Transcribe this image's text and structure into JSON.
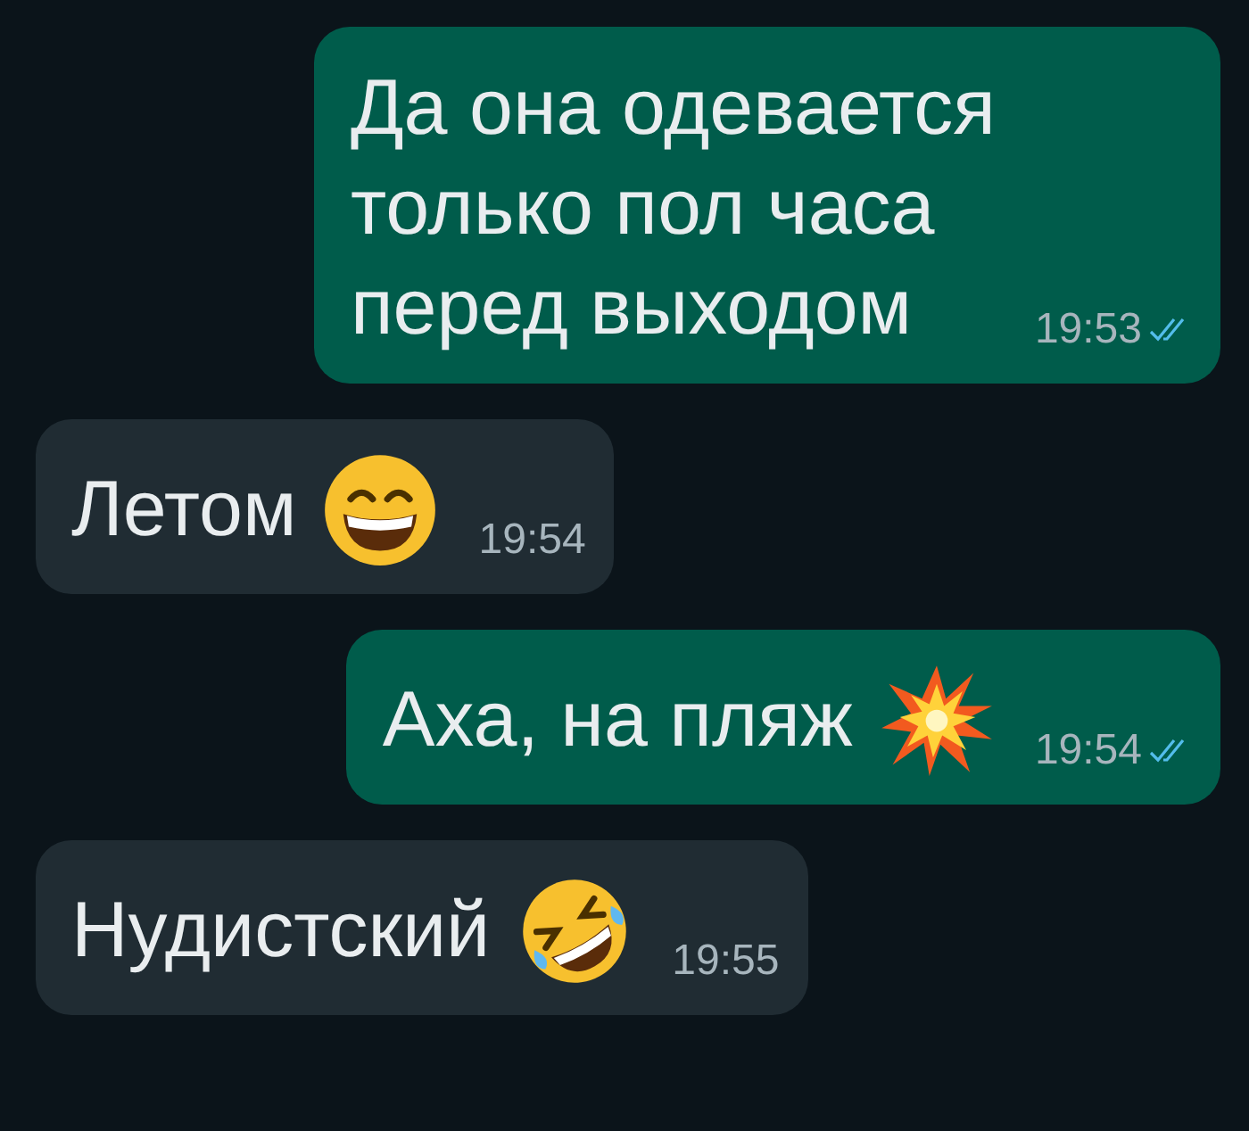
{
  "messages": [
    {
      "outgoing": true,
      "text": "Да она одевается\nтолько пол часа\nперед выходом",
      "time": "19:53",
      "read": true
    },
    {
      "outgoing": false,
      "text": "Летом",
      "emoji": {
        "kind": "grin"
      },
      "time": "19:54"
    },
    {
      "outgoing": true,
      "text": "Аха, на пляж",
      "emoji": {
        "kind": "burst"
      },
      "time": "19:54",
      "read": true
    },
    {
      "outgoing": false,
      "text": "Нудистский",
      "emoji": {
        "kind": "rofl"
      },
      "time": "19:55"
    }
  ]
}
